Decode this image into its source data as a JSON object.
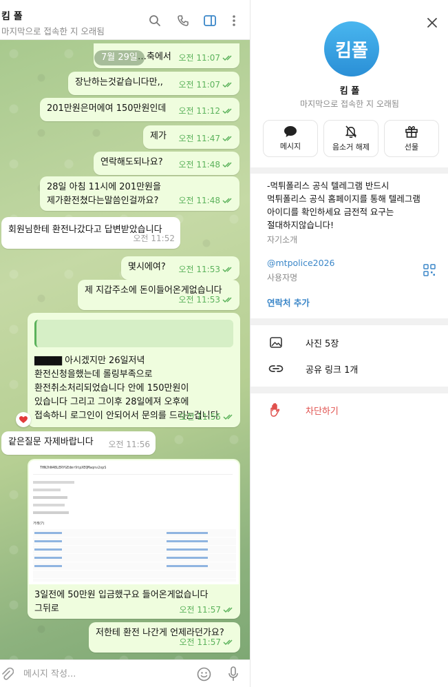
{
  "chat": {
    "title": "킴 폴",
    "status": "마지막으로 접속한 지 오래됨",
    "date_pill": "7월 29일",
    "messages": [
      {
        "dir": "out",
        "text": "…축에서",
        "time": "오전 11:07"
      },
      {
        "dir": "out",
        "text": "장난하는것같습니다만,,",
        "time": "오전 11:07"
      },
      {
        "dir": "out",
        "text": "201만원은머에여 150만원인데",
        "time": "오전 11:12"
      },
      {
        "dir": "out",
        "text": "제가",
        "time": "오전 11:47"
      },
      {
        "dir": "out",
        "text": "연락해도되나요?",
        "time": "오전 11:48"
      },
      {
        "dir": "out",
        "text": "28일 아침 11시에 201만원을\n제가환전쳤다는말씀인걸까요?",
        "time": "오전 11:48"
      },
      {
        "dir": "in",
        "text": "회원님한테 환전나갔다고 답변받았습니다",
        "time": "오전 11:52"
      },
      {
        "dir": "out",
        "text": "몇시에여?",
        "time": "오전 11:53"
      },
      {
        "dir": "out",
        "text": "제 지갑주소에 돈이들어온게없습니다",
        "time": "오전 11:53"
      },
      {
        "dir": "out",
        "text": "▇▇▇▇ 아시겠지만 26일저녁\n환전신청을했는데 롤링부족으로\n환전취소처리되었습니다 안에 150만원이\n있습니다 그리고 그이후 28일에져 오후에\n접속하니 로그인이 안되어서 문의를 드리는겁니다",
        "time": "오전 11:55"
      },
      {
        "dir": "in",
        "text": "같은질문 자제바랍니다",
        "time": "오전 11:56"
      },
      {
        "dir": "out",
        "text": "3일전에 50만원 입금했구요 들어온게없습니다\n그뒤로",
        "time": "오전 11:57"
      },
      {
        "dir": "out",
        "text": "저한테 환전 나간게 언제라던가요?",
        "time": "오전 11:57"
      }
    ],
    "reaction": "heart",
    "composer_placeholder": "메시지 작성..."
  },
  "tx_screenshot": {
    "address": "THNJhN4BLERYGEdmr9tpXEQMaqnv2opS",
    "rows_label": "거래(7)"
  },
  "profile": {
    "avatar_text": "킴폴",
    "name": "킴 폴",
    "status": "마지막으로 접속한 지 오래됨",
    "actions": [
      {
        "label": "메시지",
        "icon": "chat-bubble-icon"
      },
      {
        "label": "음소거 해제",
        "icon": "bell-off-icon"
      },
      {
        "label": "선물",
        "icon": "gift-icon"
      }
    ],
    "bio": "-먹튀폴리스 공식 텔레그램 반드시\n먹튀폴리스 공식 홈페이지를 통해 텔레그램\n아이디를 확인하세요 금전적 요구는\n절대하지않습니다!",
    "bio_label": "자기소개",
    "username": "@mtpolice2026",
    "username_label": "사용자명",
    "add_contact": "연락처 추가",
    "photos": "사진 5장",
    "links": "공유 링크 1개",
    "block": "차단하기"
  },
  "colors": {
    "accent": "#3a86c8",
    "outgoing_bubble": "#effdde",
    "check_green": "#5bb25b",
    "danger": "#e0504d"
  }
}
